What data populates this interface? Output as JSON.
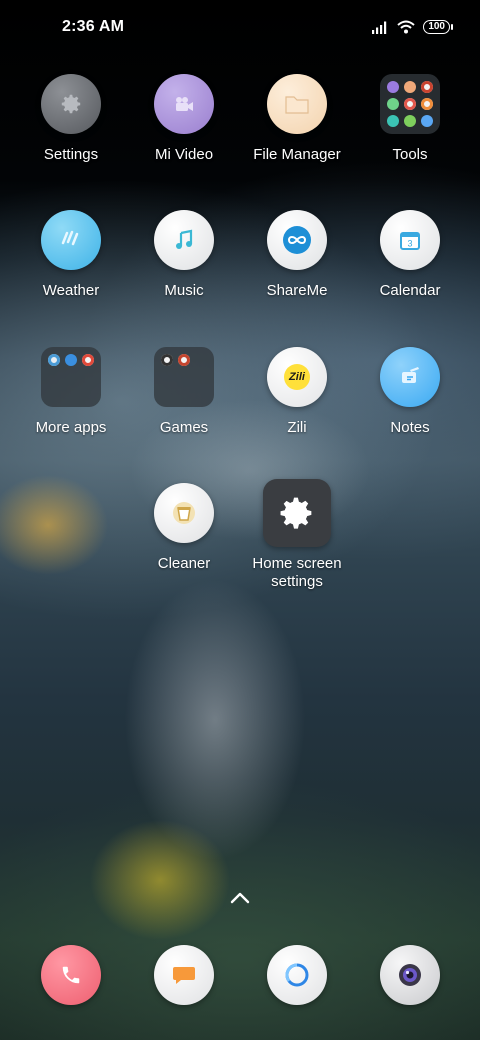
{
  "status_bar": {
    "time": "2:36 AM",
    "battery": "100"
  },
  "home": {
    "apps": [
      {
        "label": "Settings",
        "icon": "gear-icon",
        "color": "#6a6d72"
      },
      {
        "label": "Mi Video",
        "icon": "video-camera-icon",
        "color": "#a98fd6"
      },
      {
        "label": "File Manager",
        "icon": "folder-icon",
        "color": "#f6dcbc"
      },
      {
        "label": "Tools",
        "icon": "tools-folder-icon",
        "color": "#32373d"
      },
      {
        "label": "Weather",
        "icon": "weather-icon",
        "color": "#5cc6ee"
      },
      {
        "label": "Music",
        "icon": "music-note-icon",
        "color": "#f2f3f4"
      },
      {
        "label": "ShareMe",
        "icon": "infinity-icon",
        "color": "#f2f3f4"
      },
      {
        "label": "Calendar",
        "icon": "calendar-icon",
        "color": "#f2f3f4"
      },
      {
        "label": "More apps",
        "icon": "apps-folder-icon",
        "color": "#32373d"
      },
      {
        "label": "Games",
        "icon": "games-folder-icon",
        "color": "#32373d"
      },
      {
        "label": "Zili",
        "icon": "zili-logo-icon",
        "text": "Zili",
        "color": "#f2f3f4"
      },
      {
        "label": "Notes",
        "icon": "notes-icon",
        "color": "#4ab4f5"
      },
      {
        "label": "Cleaner",
        "icon": "broom-bucket-icon",
        "color": "#f2f3f4"
      },
      {
        "label": "Home screen\nsettings",
        "icon": "gear-icon",
        "color": "#3a3d41"
      }
    ]
  },
  "dock": [
    {
      "name": "phone",
      "icon": "phone-icon",
      "color": "#f2707f"
    },
    {
      "name": "messaging",
      "icon": "message-bubble-icon",
      "color": "#f2f3f4"
    },
    {
      "name": "browser",
      "icon": "browser-ring-icon",
      "color": "#f2f3f4"
    },
    {
      "name": "camera",
      "icon": "camera-lens-icon",
      "color": "#d9dadc"
    }
  ]
}
